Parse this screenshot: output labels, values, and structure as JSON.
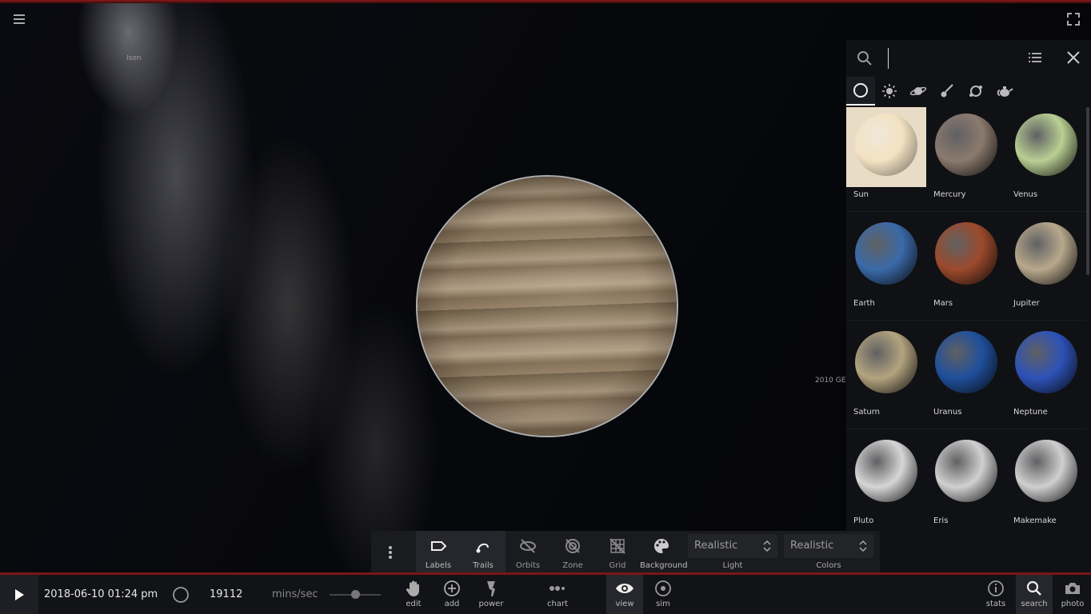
{
  "viewport": {
    "star_labels": [
      "Ison",
      "2010 GE"
    ],
    "menu_icon": "hamburger-menu-icon",
    "fullscreen_icon": "fullscreen-icon"
  },
  "search_panel": {
    "placeholder": "",
    "categories": [
      {
        "icon": "circle-all-icon",
        "active": true
      },
      {
        "icon": "star-sun-icon",
        "active": false
      },
      {
        "icon": "planet-ring-icon",
        "active": false
      },
      {
        "icon": "comet-icon",
        "active": false
      },
      {
        "icon": "orbit-icon",
        "active": false
      },
      {
        "icon": "teapot-icon",
        "active": false
      }
    ],
    "objects": [
      {
        "name": "Sun",
        "color": "#f3e2c2"
      },
      {
        "name": "Mercury",
        "color": "#8c7a6e"
      },
      {
        "name": "Venus",
        "color": "#b9cf93"
      },
      {
        "name": "Earth",
        "color": "#3a6aa8"
      },
      {
        "name": "Mars",
        "color": "#9c4a2c"
      },
      {
        "name": "Jupiter",
        "color": "#b8a88c"
      },
      {
        "name": "Saturn",
        "color": "#b3a47f"
      },
      {
        "name": "Uranus",
        "color": "#1f4f9c"
      },
      {
        "name": "Neptune",
        "color": "#2d52b8"
      },
      {
        "name": "Pluto",
        "color": "#d6d6d6"
      },
      {
        "name": "Eris",
        "color": "#d0d0d0"
      },
      {
        "name": "Makemake",
        "color": "#cfcfcf"
      }
    ]
  },
  "view_bar": {
    "tools": [
      {
        "label": "Labels",
        "icon": "label-tag-icon",
        "active": true
      },
      {
        "label": "Trails",
        "icon": "trail-icon",
        "active": true
      },
      {
        "label": "Orbits",
        "icon": "orbits-off-icon",
        "active": false
      },
      {
        "label": "Zone",
        "icon": "zone-off-icon",
        "active": false
      },
      {
        "label": "Grid",
        "icon": "grid-off-icon",
        "active": false
      },
      {
        "label": "Background",
        "icon": "palette-icon",
        "active": false
      }
    ],
    "light": {
      "value": "Realistic",
      "label": "Light"
    },
    "colors": {
      "value": "Realistic",
      "label": "Colors"
    }
  },
  "bottom_bar": {
    "datetime": "2018-06-10 01:24 pm",
    "speed": "19112",
    "speed_unit": "mins/sec",
    "speed_slider_fraction": 0.5,
    "left_tools": [
      {
        "label": "edit",
        "icon": "hand-icon"
      },
      {
        "label": "add",
        "icon": "add-circle-icon"
      },
      {
        "label": "power",
        "icon": "power-icon"
      },
      {
        "label": "chart",
        "icon": "chart-dots-icon"
      },
      {
        "label": "view",
        "icon": "eye-icon",
        "active": true
      },
      {
        "label": "sim",
        "icon": "sim-orbit-icon"
      }
    ],
    "right_tools": [
      {
        "label": "stats",
        "icon": "info-icon"
      },
      {
        "label": "search",
        "icon": "search-icon",
        "active": true
      },
      {
        "label": "photo",
        "icon": "camera-icon"
      }
    ]
  }
}
